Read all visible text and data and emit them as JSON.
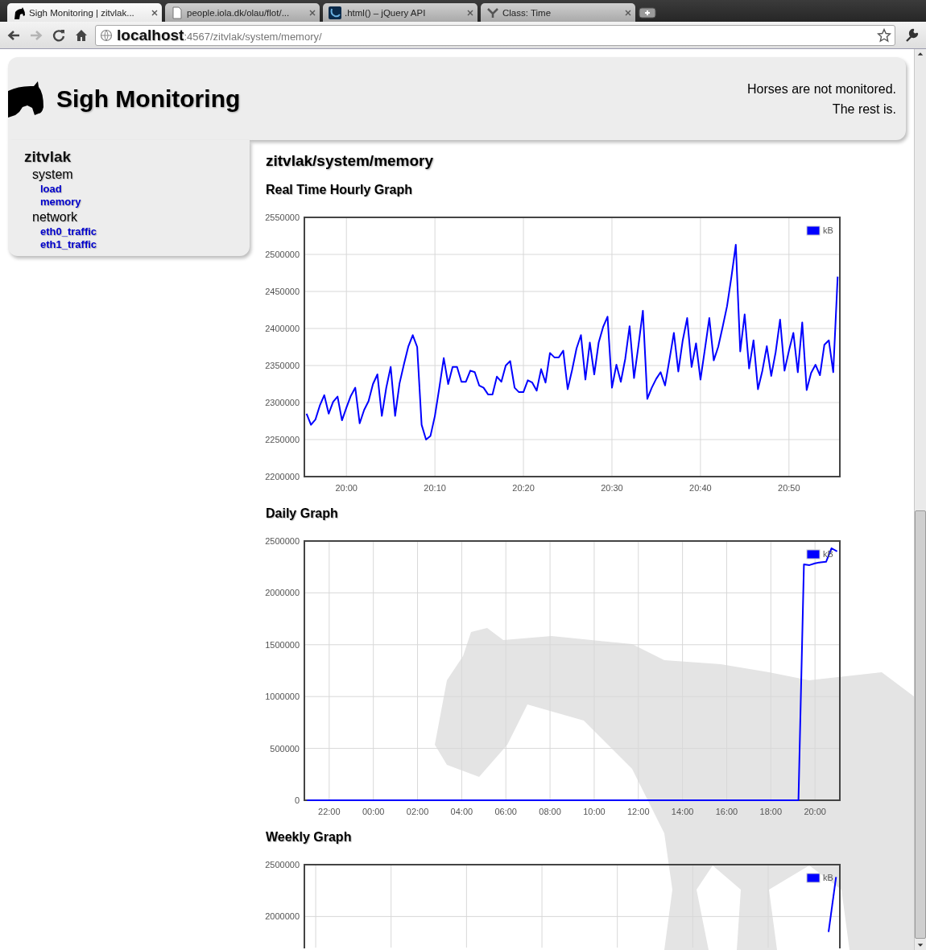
{
  "browser": {
    "tabs": [
      {
        "kind": "horse",
        "title": "Sigh Monitoring | zitvlak...",
        "selected": true
      },
      {
        "kind": "page",
        "title": "people.iola.dk/olau/flot/...",
        "selected": false
      },
      {
        "kind": "jquery",
        "title": ".html() – jQuery API",
        "selected": false
      },
      {
        "kind": "yahoo",
        "title": "Class: Time",
        "selected": false
      }
    ],
    "nav": [
      {
        "kind": "back",
        "disabled": false
      },
      {
        "kind": "forward",
        "disabled": true
      },
      {
        "kind": "reload",
        "disabled": false
      },
      {
        "kind": "home",
        "disabled": false
      }
    ],
    "address": {
      "host": "localhost",
      "rest": ":4567/zitvlak/system/memory/"
    }
  },
  "header": {
    "title": "Sigh Monitoring",
    "tagline": [
      "Horses are not monitored.",
      "The rest is."
    ]
  },
  "sidebar": {
    "tree": [
      {
        "label": "zitvlak",
        "children": [
          {
            "label": "system",
            "children": [
              {
                "label": "load"
              },
              {
                "label": "memory"
              }
            ]
          },
          {
            "label": "network",
            "children": [
              {
                "label": "eth0_traffic"
              },
              {
                "label": "eth1_traffic"
              }
            ]
          }
        ]
      }
    ]
  },
  "content": {
    "heading": "zitvlak/system/memory",
    "graphs": [
      {
        "title": "Real Time Hourly Graph",
        "chart_data": {
          "type": "line",
          "categories": [
            null,
            null,
            null,
            null,
            null,
            null,
            null,
            null,
            null,
            "20:00",
            null,
            null,
            null,
            null,
            null,
            null,
            null,
            null,
            null,
            null,
            null,
            null,
            null,
            null,
            null,
            null,
            null,
            null,
            null,
            "20:10",
            null,
            null,
            null,
            null,
            null,
            null,
            null,
            null,
            null,
            null,
            null,
            null,
            null,
            null,
            null,
            null,
            null,
            null,
            null,
            "20:20",
            null,
            null,
            null,
            null,
            null,
            null,
            null,
            null,
            null,
            null,
            null,
            null,
            null,
            null,
            null,
            null,
            null,
            null,
            null,
            "20:30",
            null,
            null,
            null,
            null,
            null,
            null,
            null,
            null,
            null,
            null,
            null,
            null,
            null,
            null,
            null,
            null,
            null,
            null,
            null,
            "20:40",
            null,
            null,
            null,
            null,
            null,
            null,
            null,
            null,
            null,
            null,
            null,
            null,
            null,
            null,
            null,
            null,
            null,
            null,
            null,
            "20:50",
            null,
            null,
            null,
            null,
            null,
            null,
            null,
            null,
            null,
            null,
            null
          ],
          "series": [
            {
              "name": "kB",
              "color": "#0000ff",
              "values": [
                2285000,
                2270000,
                2277000,
                2296000,
                2310000,
                2285000,
                2301000,
                2308000,
                2276000,
                2293000,
                2309000,
                2320000,
                2272000,
                2290000,
                2302000,
                2325000,
                2338000,
                2282000,
                2320000,
                2348000,
                2282000,
                2326000,
                2352000,
                2376000,
                2391000,
                2375000,
                2270000,
                2250000,
                2255000,
                2282000,
                2320000,
                2360000,
                2325000,
                2348000,
                2348000,
                2328000,
                2328000,
                2343000,
                2341000,
                2323000,
                2320000,
                2311000,
                2311000,
                2335000,
                2328000,
                2350000,
                2356000,
                2320000,
                2314000,
                2314000,
                2330000,
                2327000,
                2316000,
                2345000,
                2327000,
                2367000,
                2361000,
                2361000,
                2370000,
                2318000,
                2344000,
                2373000,
                2391000,
                2331000,
                2381000,
                2338000,
                2381000,
                2402000,
                2416000,
                2320000,
                2351000,
                2328000,
                2359000,
                2403000,
                2333000,
                2377000,
                2424000,
                2305000,
                2320000,
                2332000,
                2341000,
                2323000,
                2358000,
                2394000,
                2342000,
                2384000,
                2414000,
                2348000,
                2380000,
                2331000,
                2372000,
                2414000,
                2357000,
                2375000,
                2402000,
                2430000,
                2470000,
                2513000,
                2369000,
                2419000,
                2346000,
                2384000,
                2318000,
                2343000,
                2376000,
                2336000,
                2368000,
                2412000,
                2343000,
                2370000,
                2394000,
                2341000,
                2408000,
                2317000,
                2340000,
                2351000,
                2337000,
                2378000,
                2384000,
                2341000,
                2470000
              ]
            }
          ],
          "ylim": [
            2200000,
            2550000
          ],
          "grid": true,
          "yticks": [
            2200000,
            2250000,
            2300000,
            2350000,
            2400000,
            2450000,
            2500000,
            2550000
          ]
        }
      },
      {
        "title": "Daily Graph",
        "chart_data": {
          "type": "line",
          "categories": [
            null,
            null,
            null,
            null,
            "22:00",
            null,
            null,
            null,
            null,
            null,
            null,
            null,
            "00:00",
            null,
            null,
            null,
            null,
            null,
            null,
            null,
            "02:00",
            null,
            null,
            null,
            null,
            null,
            null,
            null,
            "04:00",
            null,
            null,
            null,
            null,
            null,
            null,
            null,
            "06:00",
            null,
            null,
            null,
            null,
            null,
            null,
            null,
            "08:00",
            null,
            null,
            null,
            null,
            null,
            null,
            null,
            "10:00",
            null,
            null,
            null,
            null,
            null,
            null,
            null,
            "12:00",
            null,
            null,
            null,
            null,
            null,
            null,
            null,
            "14:00",
            null,
            null,
            null,
            null,
            null,
            null,
            null,
            "16:00",
            null,
            null,
            null,
            null,
            null,
            null,
            null,
            "18:00",
            null,
            null,
            null,
            null,
            null,
            null,
            null,
            "20:00",
            null,
            null,
            null,
            null
          ],
          "series": [
            {
              "name": "kB",
              "color": "#0000ff",
              "values": [
                0,
                0,
                0,
                0,
                0,
                0,
                0,
                0,
                0,
                0,
                0,
                0,
                0,
                0,
                0,
                0,
                0,
                0,
                0,
                0,
                0,
                0,
                0,
                0,
                0,
                0,
                0,
                0,
                0,
                0,
                0,
                0,
                0,
                0,
                0,
                0,
                0,
                0,
                0,
                0,
                0,
                0,
                0,
                0,
                0,
                0,
                0,
                0,
                0,
                0,
                0,
                0,
                0,
                0,
                0,
                0,
                0,
                0,
                0,
                0,
                0,
                0,
                0,
                0,
                0,
                0,
                0,
                0,
                0,
                0,
                0,
                0,
                0,
                0,
                0,
                0,
                0,
                0,
                0,
                0,
                0,
                0,
                0,
                0,
                0,
                0,
                0,
                0,
                0,
                0,
                2275000,
                2268000,
                2285000,
                2295000,
                2300000,
                2430000,
                2400000
              ]
            }
          ],
          "ylim": [
            0,
            2500000
          ],
          "grid": true,
          "yticks": [
            0,
            500000,
            1000000,
            1500000,
            2000000,
            2500000
          ]
        }
      },
      {
        "title": "Weekly Graph",
        "chart_data": {
          "type": "line",
          "categories": [
            null,
            null,
            null,
            null,
            null,
            null,
            null,
            null,
            null,
            null,
            null,
            null,
            null,
            null,
            null,
            null,
            null,
            null,
            null,
            null,
            null,
            null,
            null,
            null,
            null,
            null,
            null,
            null,
            null,
            null,
            null,
            null,
            null,
            null,
            null,
            null,
            null,
            null,
            null,
            null,
            null,
            null,
            null,
            null,
            null,
            null,
            null,
            null,
            null,
            null,
            null,
            null,
            null,
            null,
            null,
            null,
            null,
            null,
            null,
            null,
            null,
            null,
            null,
            null,
            null,
            null,
            null,
            null,
            null,
            null,
            null
          ],
          "series": [
            {
              "name": "kB",
              "color": "#0000ff",
              "values": [
                null,
                null,
                null,
                null,
                null,
                null,
                null,
                null,
                null,
                null,
                null,
                null,
                null,
                null,
                null,
                null,
                null,
                null,
                null,
                null,
                null,
                null,
                null,
                null,
                null,
                null,
                null,
                null,
                null,
                null,
                null,
                null,
                null,
                null,
                null,
                null,
                null,
                null,
                null,
                null,
                null,
                null,
                null,
                null,
                null,
                null,
                null,
                null,
                null,
                null,
                null,
                null,
                null,
                null,
                null,
                null,
                null,
                null,
                null,
                null,
                null,
                null,
                null,
                null,
                null,
                null,
                null,
                null,
                null,
                1850000,
                2380000
              ]
            }
          ],
          "ylim": [
            1700000,
            2500000
          ],
          "grid": true,
          "yticks": [
            2000000,
            2500000
          ]
        }
      }
    ]
  }
}
